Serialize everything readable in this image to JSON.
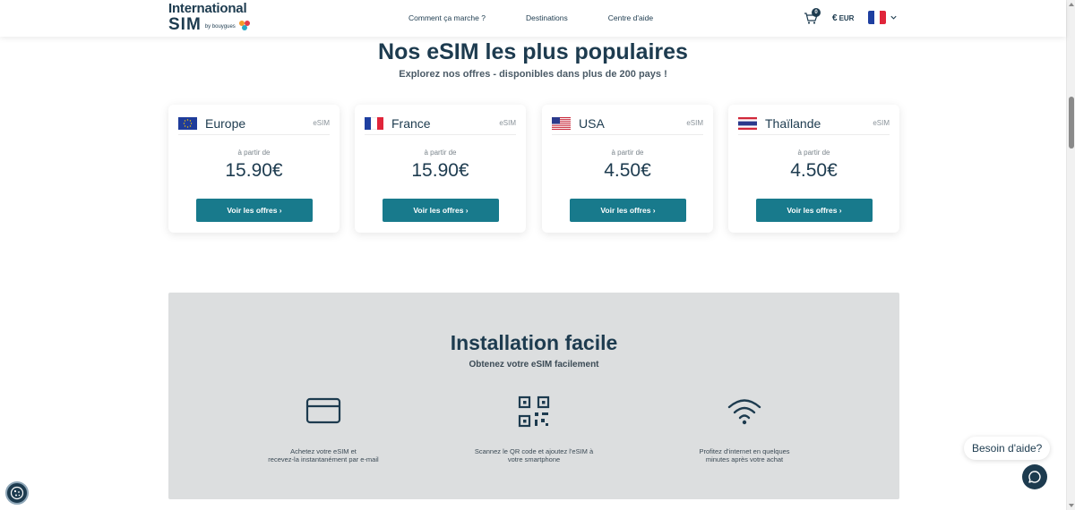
{
  "header": {
    "logo": {
      "line1": "International",
      "line2": "SIM",
      "by": "by bouygues"
    },
    "nav": [
      "Comment ça marche ?",
      "Destinations",
      "Centre d'aide"
    ],
    "cart_count": "0",
    "currency_symbol": "€",
    "currency": "EUR"
  },
  "popular": {
    "title": "Nos eSIM les plus populaires",
    "subtitle": "Explorez nos offres - disponibles dans plus de 200 pays !",
    "cards": [
      {
        "name": "Europe",
        "tag": "eSIM",
        "from": "à partir de",
        "price": "15.90€",
        "button": "Voir les offres ›"
      },
      {
        "name": "France",
        "tag": "eSIM",
        "from": "à partir de",
        "price": "15.90€",
        "button": "Voir les offres ›"
      },
      {
        "name": "USA",
        "tag": "eSIM",
        "from": "à partir de",
        "price": "4.50€",
        "button": "Voir les offres ›"
      },
      {
        "name": "Thaïlande",
        "tag": "eSIM",
        "from": "à partir de",
        "price": "4.50€",
        "button": "Voir les offres ›"
      }
    ]
  },
  "install": {
    "title": "Installation facile",
    "subtitle": "Obtenez votre eSIM facilement",
    "steps": [
      {
        "icon": "credit-card-icon",
        "line1": "Achetez votre eSIM et",
        "line2": "recevez-la instantanément par e-mail"
      },
      {
        "icon": "qr-code-icon",
        "line1": "Scannez le QR code et ajoutez l'eSIM à",
        "line2": "votre smartphone"
      },
      {
        "icon": "wifi-icon",
        "line1": "Profitez d'internet en quelques",
        "line2": "minutes après votre achat"
      }
    ]
  },
  "help": {
    "label": "Besoin d'aide?"
  },
  "colors": {
    "primary": "#1d3b4f",
    "button": "#187a8c",
    "section_bg": "#dcdedf"
  }
}
